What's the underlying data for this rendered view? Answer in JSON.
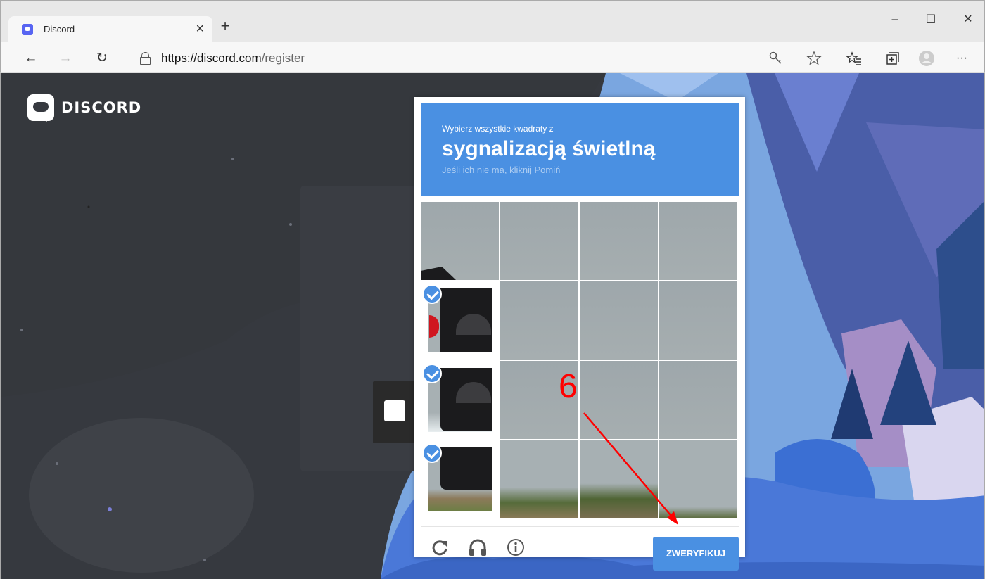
{
  "browser": {
    "tab_title": "Discord",
    "tab_close": "×",
    "new_tab": "+",
    "window_controls": {
      "minimize": "–",
      "maximize": "☐",
      "close": "✕"
    },
    "nav": {
      "back": "←",
      "forward": "→",
      "refresh": "↻"
    },
    "url_host": "https://discord.com",
    "url_path": "/register",
    "toolbar_icons": [
      "key-icon",
      "star-icon",
      "favorites-icon",
      "collections-icon",
      "profile-icon",
      "more-icon"
    ],
    "more": "···"
  },
  "page": {
    "logo_text": "DISCORD"
  },
  "captcha": {
    "prompt": "Wybierz wszystkie kwadraty z",
    "target": "sygnalizacją świetlną",
    "hint": "Jeśli ich nie ma, kliknij Pomiń",
    "selected_tiles": [
      4,
      8,
      12
    ],
    "verify_label": "ZWERYFIKUJ",
    "footer_icons": [
      "refresh-icon",
      "headphones-icon",
      "info-icon"
    ]
  },
  "annotation": {
    "number": "6",
    "color": "#ff0000"
  },
  "colors": {
    "captcha_blue": "#4a90e2",
    "discord_dark": "#36393f"
  }
}
